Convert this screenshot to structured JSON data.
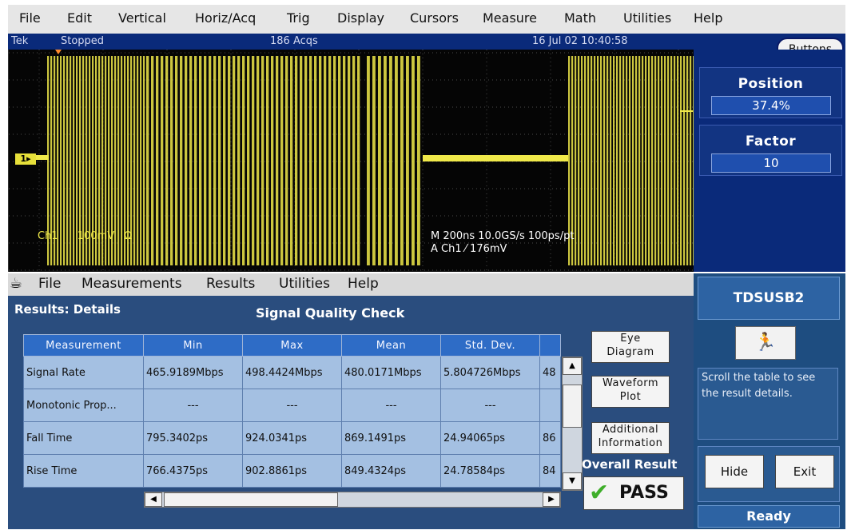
{
  "menu": [
    "File",
    "Edit",
    "Vertical",
    "Horiz/Acq",
    "Trig",
    "Display",
    "Cursors",
    "Measure",
    "Math",
    "Utilities",
    "Help"
  ],
  "status": {
    "brand": "Tek",
    "state": "Stopped",
    "acqs": "186 Acqs",
    "datetime": "16 Jul 02 10:40:58"
  },
  "buttons_label": "Buttons",
  "channel": {
    "marker": "1",
    "label": "Ch1",
    "scale": "100mV",
    "coupling": "Ω"
  },
  "timebase": {
    "line1": "M 200ns 10.0GS/s  100ps/pt",
    "line2": "A  Ch1  ⁄  176mV"
  },
  "controls": [
    {
      "title": "Position",
      "value": "37.4%"
    },
    {
      "title": "Factor",
      "value": "10"
    }
  ],
  "app_menu": [
    "File",
    "Measurements",
    "Results",
    "Utilities",
    "Help"
  ],
  "results_title": "Results: Details",
  "table_title": "Signal Quality Check",
  "table": {
    "headers": [
      "Measurement",
      "Min",
      "Max",
      "Mean",
      "Std. Dev.",
      ""
    ],
    "rows": [
      [
        "Signal Rate",
        "465.9189Mbps",
        "498.4424Mbps",
        "480.0171Mbps",
        "5.804726Mbps",
        "48"
      ],
      [
        "Monotonic Prop...",
        "---",
        "---",
        "---",
        "---",
        ""
      ],
      [
        "Fall Time",
        "795.3402ps",
        "924.0341ps",
        "869.1491ps",
        "24.94065ps",
        "86"
      ],
      [
        "Rise Time",
        "766.4375ps",
        "902.8861ps",
        "849.4324ps",
        "24.78584ps",
        "84"
      ]
    ]
  },
  "side_buttons": {
    "eye": [
      "Eye",
      "Diagram"
    ],
    "waveform": [
      "Waveform",
      "Plot"
    ],
    "additional": [
      "Additional",
      "Information"
    ]
  },
  "overall_label": "Overall Result",
  "pass_label": "PASS",
  "app_name": "TDSUSB2",
  "runner_icon": "🏃",
  "help_text": "Scroll the table to see the result details.",
  "hide_label": "Hide",
  "exit_label": "Exit",
  "ready_label": "Ready",
  "colors": {
    "trace": "#f0e94a",
    "navy": "#0a2a7a",
    "panel": "#2a4d7e",
    "table_cell": "#a4c0e2",
    "pass_green": "#3fae2a"
  }
}
